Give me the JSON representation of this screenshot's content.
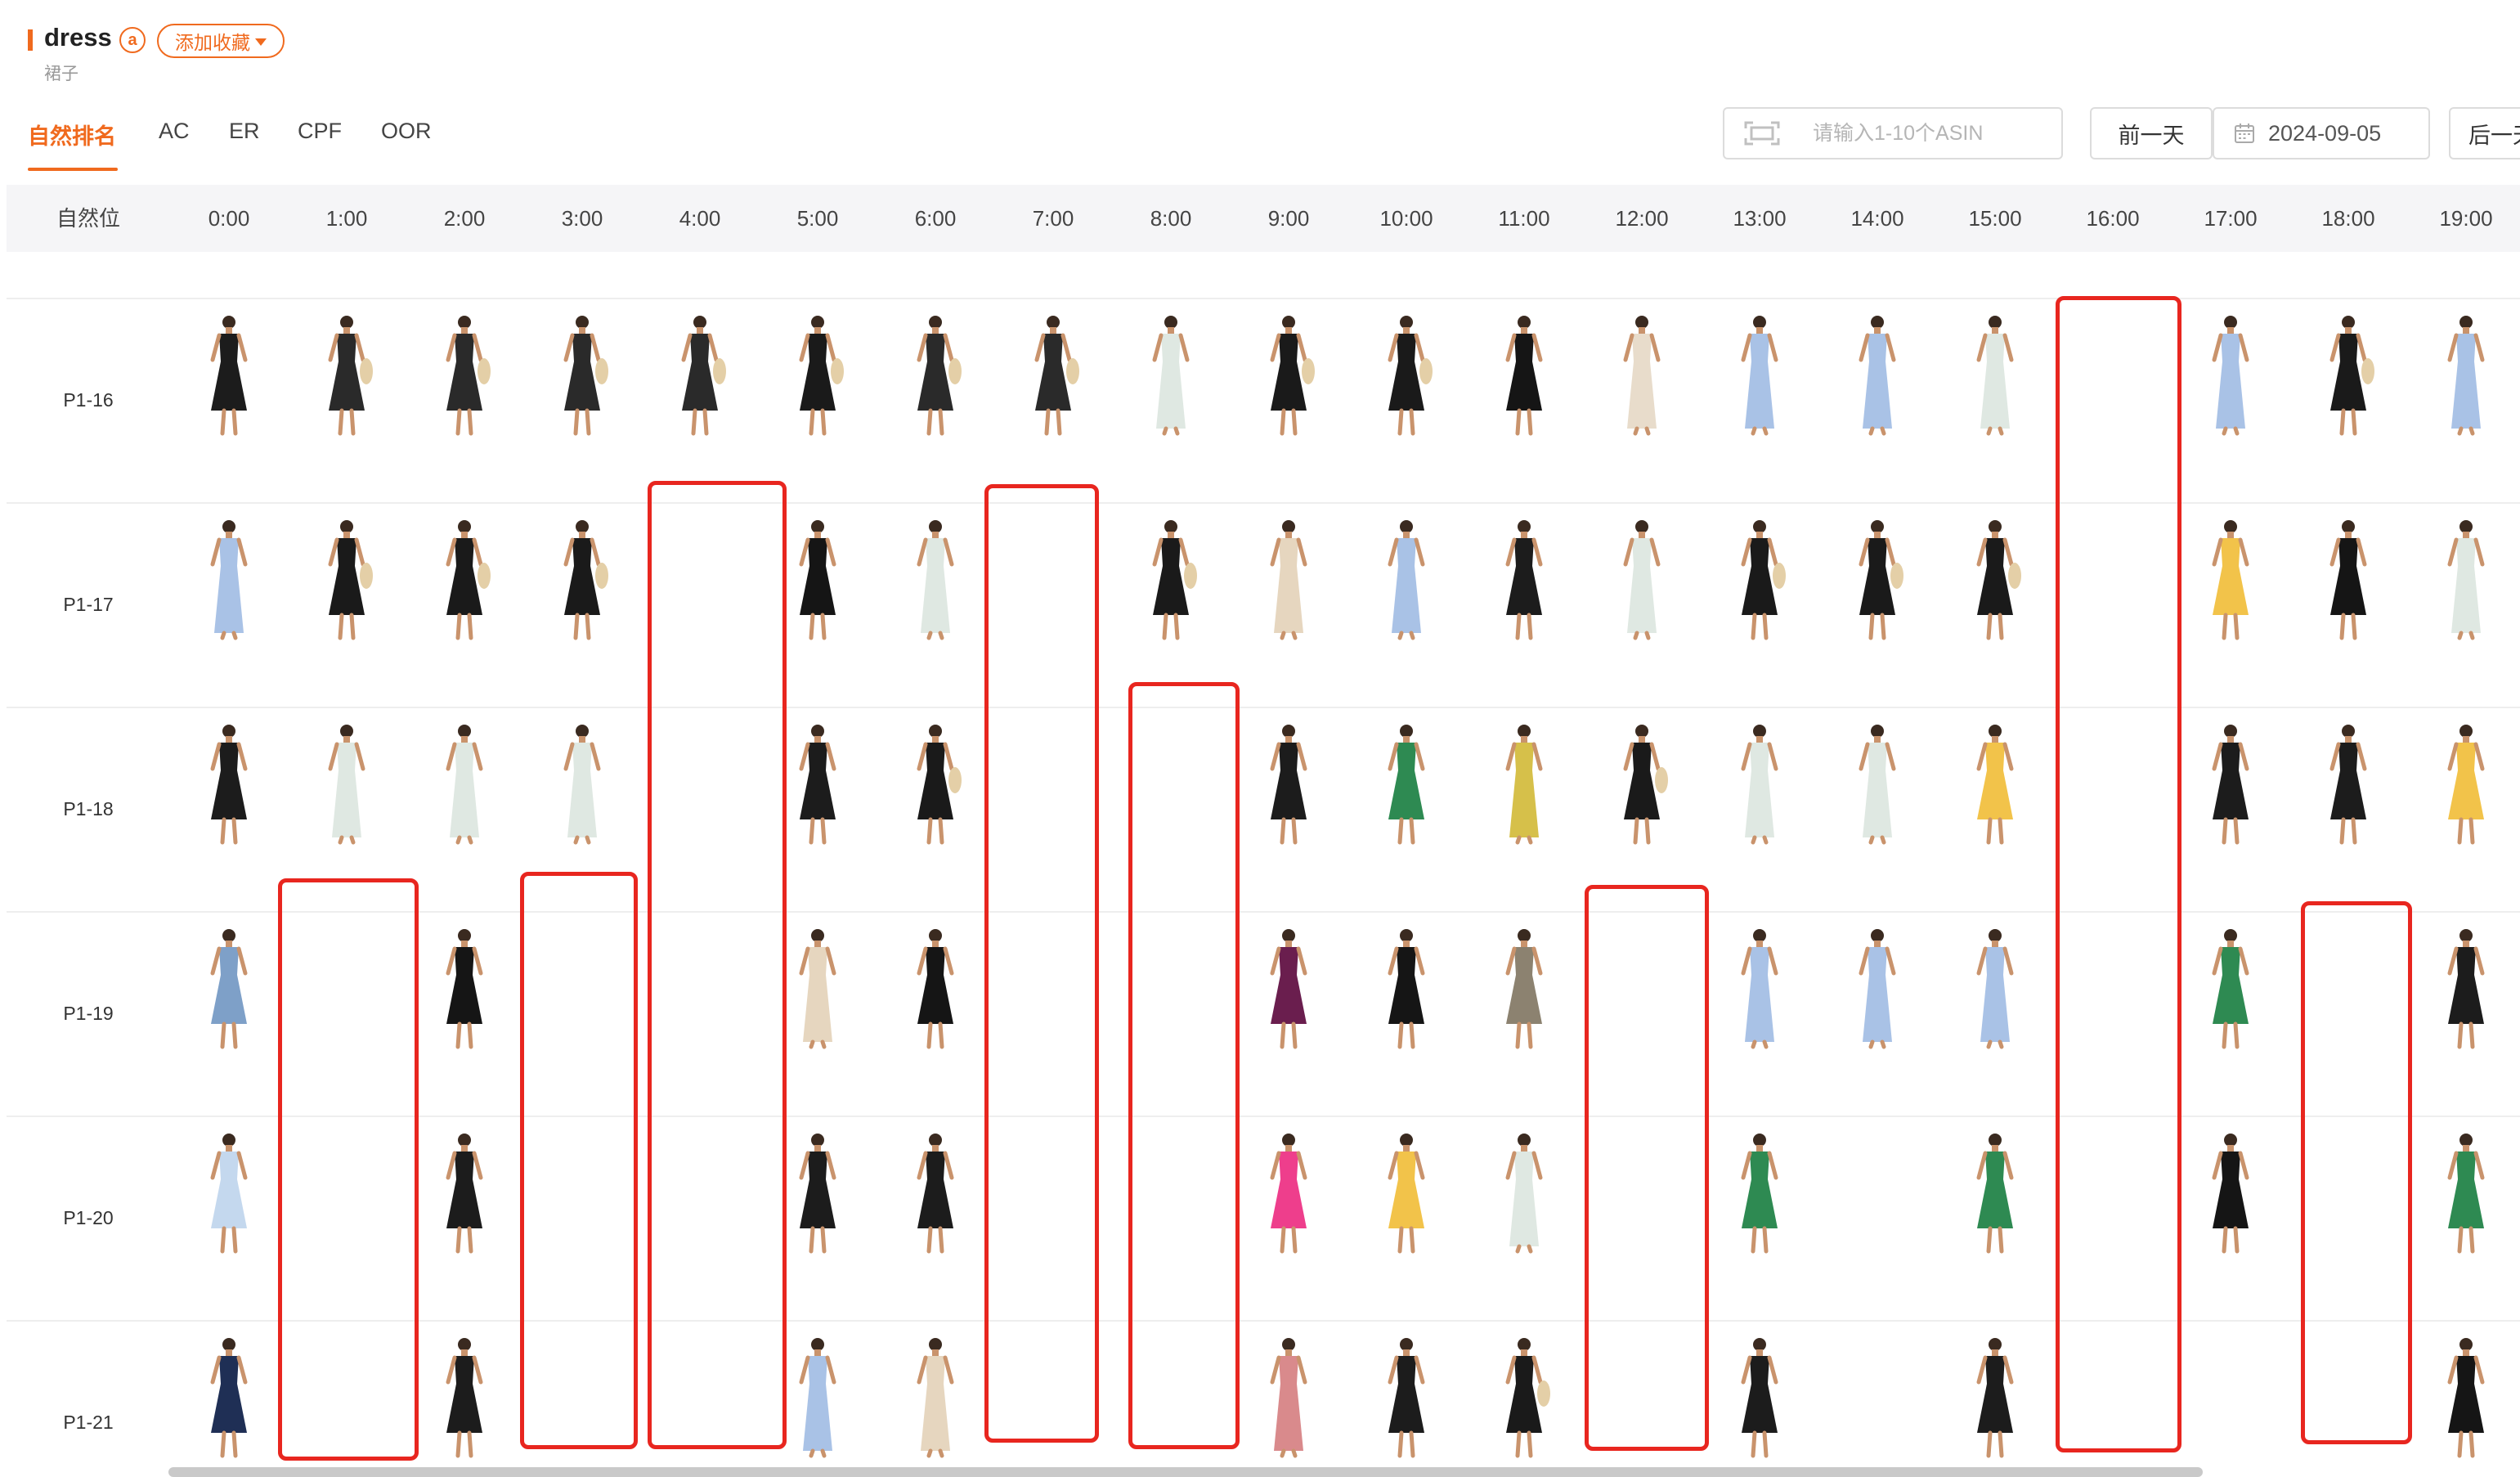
{
  "header": {
    "keyword": "dress",
    "marketplace_badge": "a",
    "favorite_label": "添加收藏",
    "subtitle": "裙子"
  },
  "tabs": [
    {
      "label": "自然排名",
      "active": true
    },
    {
      "label": "AC",
      "active": false
    },
    {
      "label": "ER",
      "active": false
    },
    {
      "label": "CPF",
      "active": false
    },
    {
      "label": "OOR",
      "active": false
    }
  ],
  "toolbar": {
    "asin_placeholder": "请输入1-10个ASIN",
    "prev_day_label": "前一天",
    "date_value": "2024-09-05",
    "next_day_label": "后一天"
  },
  "table": {
    "position_header": "自然位",
    "hours": [
      "0:00",
      "1:00",
      "2:00",
      "3:00",
      "4:00",
      "5:00",
      "6:00",
      "7:00",
      "8:00",
      "9:00",
      "10:00",
      "11:00",
      "12:00",
      "13:00",
      "14:00",
      "15:00",
      "16:00",
      "17:00",
      "18:00",
      "19:00"
    ],
    "rows": [
      {
        "label": "P1-16",
        "cells": [
          "black-ruffle",
          "black-smock-bag",
          "black-smock-bag",
          "black-smock-bag",
          "black-smock-bag",
          "black-bag",
          "black-smock-bag",
          "black-smock-bag",
          "floral-halter",
          "black-bag",
          "black-bag",
          "black-short",
          "beige-pleat",
          "lightblue-maxi",
          "lightblue-maxi",
          "floral-halter",
          null,
          "lightblue-maxi",
          "black-bag",
          "lightblue-maxi"
        ]
      },
      {
        "label": "P1-17",
        "cells": [
          "lightblue-maxi",
          "black-bag",
          "black-bag",
          "black-bag",
          null,
          "black-short",
          "floral-halter",
          null,
          "black-bag",
          "beige-maxi",
          "lightblue-maxi",
          "black-ruffle",
          "floral-halter",
          "black-bag",
          "black-bag",
          "black-bag",
          null,
          "yellow-floral",
          "black-short",
          "floral-halter"
        ]
      },
      {
        "label": "P1-18",
        "cells": [
          "black-ruffle",
          "floral-halter",
          "floral-halter",
          "floral-halter",
          null,
          "black-ruffle",
          "black-bag",
          null,
          null,
          "black-ruffle",
          "green-floral",
          "mustard-maxi",
          "black-bag",
          "floral-halter",
          "floral-halter",
          "yellow-floral",
          null,
          "black-ruffle",
          "black-ruffle",
          "yellow-floral"
        ]
      },
      {
        "label": "P1-19",
        "cells": [
          "denim-shirt",
          null,
          "black-short",
          null,
          null,
          "beige-maxi",
          "black-short",
          null,
          null,
          "purple-floral",
          "black-short",
          "olive-shirt",
          null,
          "lightblue-maxi",
          "lightblue-maxi",
          "lightblue-maxi",
          null,
          "green-floral",
          null,
          "black-ruffle"
        ]
      },
      {
        "label": "P1-20",
        "cells": [
          "lightblue-shirt",
          null,
          "black-ruffle",
          null,
          null,
          "black-ruffle",
          "black-ruffle",
          null,
          null,
          "pink-short",
          "yellow-floral",
          "floral-halter",
          null,
          "green-floral",
          null,
          "green-floral",
          null,
          "black-short",
          null,
          "green-floral"
        ]
      },
      {
        "label": "P1-21",
        "cells": [
          "navy-wrap",
          null,
          "black-ruffle",
          null,
          null,
          "lightblue-maxi",
          "beige-maxi",
          null,
          null,
          "floral-pink",
          "black-ruffle",
          "black-bag",
          null,
          "black-ruffle",
          null,
          "black-ruffle",
          null,
          null,
          null,
          "black-short"
        ]
      }
    ]
  },
  "palette": {
    "accent": "#f06a1e",
    "annotation_red": "#e8261f",
    "black-ruffle": "#1c1c1c",
    "black-smock-bag": "#2a2a2a",
    "black-bag": "#1a1a1a",
    "black-short": "#151515",
    "floral-halter": "#dfe8e2",
    "beige-pleat": "#e8dccb",
    "lightblue-maxi": "#a9c2e6",
    "beige-maxi": "#e6d6bf",
    "yellow-floral": "#f2c34a",
    "green-floral": "#2e8a52",
    "mustard-maxi": "#d6c04a",
    "denim-shirt": "#7ea0c8",
    "purple-floral": "#6a1e4e",
    "olive-shirt": "#8c8270",
    "lightblue-shirt": "#c4d8ee",
    "pink-short": "#ee3e8c",
    "navy-wrap": "#1f2f55",
    "floral-pink": "#d98a8c"
  }
}
